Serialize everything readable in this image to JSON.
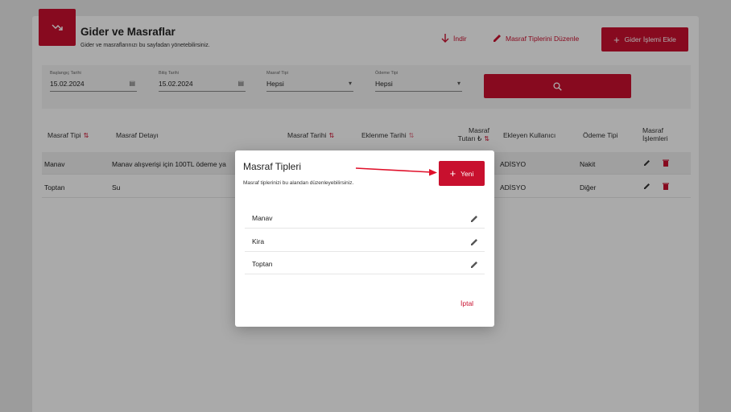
{
  "header": {
    "title": "Gider ve Masraflar",
    "subtitle": "Gider ve masraflarınızı bu sayfadan yönetebilirsiniz.",
    "icon": "trending-down-icon"
  },
  "toolbar": {
    "download_label": "İndir",
    "edit_types_label": "Masraf Tiplerini Düzenle",
    "add_expense_label": "Gider İşlemi Ekle"
  },
  "filters": {
    "start_date": {
      "label": "Başlangıç Tarihi",
      "value": "15.02.2024"
    },
    "end_date": {
      "label": "Bitiş Tarihi",
      "value": "15.02.2024"
    },
    "expense_type": {
      "label": "Masraf Tipi",
      "value": "Hepsi"
    },
    "payment_type": {
      "label": "Ödeme Tipi",
      "value": "Hepsi"
    }
  },
  "table": {
    "columns": {
      "type": "Masraf Tipi",
      "detail": "Masraf Detayı",
      "date": "Masraf Tarihi",
      "added": "Eklenme Tarihi",
      "amount_1": "Masraf",
      "amount_2": "Tutarı ₺",
      "user": "Ekleyen Kullanıcı",
      "payment": "Ödeme Tipi",
      "ops_1": "Masraf",
      "ops_2": "İşlemleri"
    },
    "rows": [
      {
        "type": "Manav",
        "detail": "Manav alışverişi için 100TL ödeme ya",
        "user": "ADİSYO",
        "payment": "Nakit"
      },
      {
        "type": "Toptan",
        "detail": "Su",
        "user": "ADİSYO",
        "payment": "Diğer"
      }
    ]
  },
  "modal": {
    "title": "Masraf Tipleri",
    "subtitle": "Masraf tiplerinizi bu alandan düzenleyebilirsiniz.",
    "new_label": "Yeni",
    "items": [
      "Manav",
      "Kira",
      "Toptan"
    ],
    "cancel_label": "İptal"
  },
  "colors": {
    "accent": "#c8102e",
    "overlay": "rgba(0,0,0,0.32)"
  }
}
